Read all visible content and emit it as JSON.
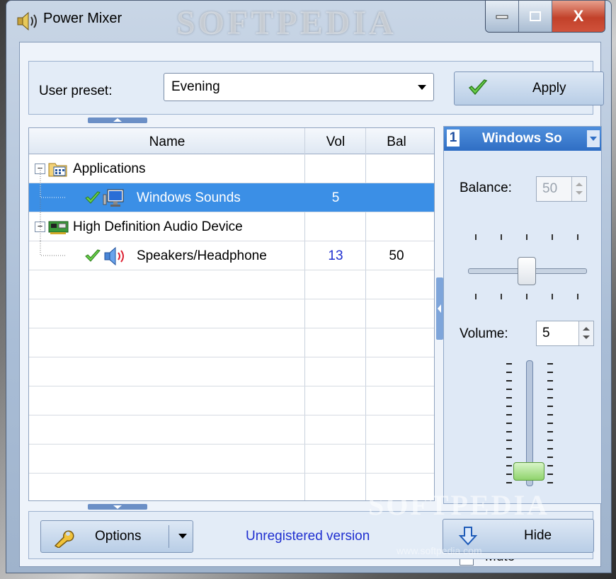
{
  "window": {
    "title": "Power Mixer",
    "watermark": "SOFTPEDIA",
    "watermark_url": "www.softpedia.com",
    "buttons": {
      "minimize": "minimize",
      "maximize": "maximize",
      "close": "X"
    }
  },
  "preset": {
    "label": "User preset:",
    "selected": "Evening",
    "apply_label": "Apply"
  },
  "grid": {
    "columns": [
      "Name",
      "Vol",
      "Bal"
    ],
    "rows": [
      {
        "name": "Applications",
        "vol": "",
        "bal": "",
        "type": "group",
        "icon": "applications-folder-icon"
      },
      {
        "name": "Windows Sounds",
        "vol": "5",
        "bal": "",
        "type": "item",
        "selected": true,
        "icon": "monitor-icon"
      },
      {
        "name": "High Definition Audio Device",
        "vol": "",
        "bal": "",
        "type": "group",
        "icon": "sound-card-icon"
      },
      {
        "name": "Speakers/Headphone",
        "vol": "13",
        "bal": "50",
        "type": "item",
        "selected": false,
        "icon": "speaker-icon"
      }
    ]
  },
  "channel": {
    "number": "1",
    "name": "Windows So",
    "balance_label": "Balance:",
    "balance_value": "50",
    "volume_label": "Volume:",
    "volume_value": "5",
    "mute_label": "Mute",
    "muted": false
  },
  "footer": {
    "options_label": "Options",
    "status_text": "Unregistered version",
    "hide_label": "Hide"
  },
  "colors": {
    "selection": "#3b8fe6",
    "link_blue": "#1f2fd0",
    "accent": "#2f6ec4"
  }
}
